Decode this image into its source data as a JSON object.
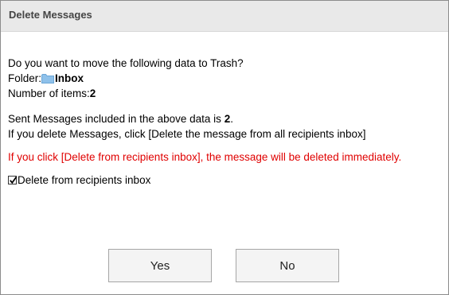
{
  "dialog": {
    "title": "Delete Messages"
  },
  "content": {
    "question": "Do you want to move the following data to Trash?",
    "folder_label": "Folder:",
    "folder_icon": "folder-icon",
    "folder_name": "Inbox",
    "items_label": "Number of items:",
    "items_count": "2",
    "sent_prefix": "Sent Messages included in the above data is ",
    "sent_count": "2",
    "sent_suffix": ".",
    "instruction": "If you delete Messages, click [Delete the message from all recipients inbox]",
    "warning": "If you click [Delete from recipients inbox], the message will be deleted immediately.",
    "checkbox_label": "Delete from recipients inbox",
    "checkbox_checked": true
  },
  "buttons": {
    "yes_label": "Yes",
    "no_label": "No"
  },
  "colors": {
    "warning": "#e00000",
    "titlebar_bg": "#e9e9e9",
    "folder_icon": "#8fc1ea"
  }
}
